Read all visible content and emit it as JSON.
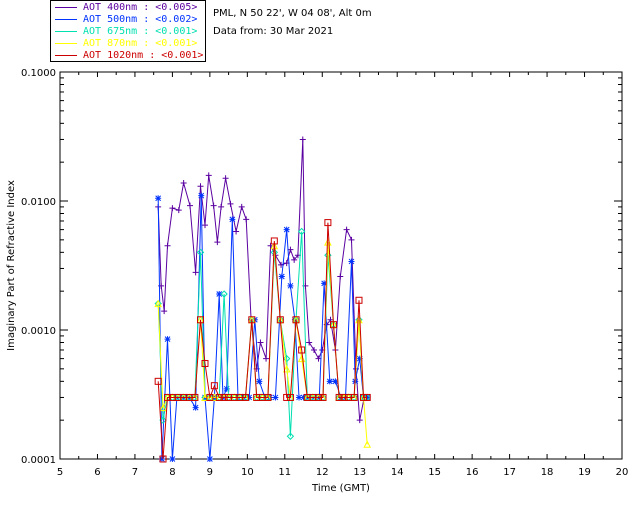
{
  "header": {
    "location": "PML, N 50 22', W 04 08', Alt 0m",
    "date_line": "Data from: 30 Mar 2021"
  },
  "legend": [
    {
      "label": "AOT  400nm : <0.005>",
      "color": "#5a00a0"
    },
    {
      "label": "AOT  500nm : <0.002>",
      "color": "#0033ff"
    },
    {
      "label": "AOT  675nm : <0.001>",
      "color": "#00e0b0"
    },
    {
      "label": "AOT  870nm : <0.001>",
      "color": "#ffff00"
    },
    {
      "label": "AOT 1020nm : <0.001>",
      "color": "#cc0000"
    }
  ],
  "chart_data": {
    "type": "line",
    "title": "",
    "xlabel": "Time (GMT)",
    "ylabel": "Imaginary Part of Refractive Index",
    "xlim": [
      5,
      20
    ],
    "ylim": [
      0.0001,
      0.1
    ],
    "yscale": "log",
    "x_ticks": [
      "5",
      "6",
      "7",
      "8",
      "9",
      "10",
      "11",
      "12",
      "13",
      "14",
      "15",
      "16",
      "17",
      "18",
      "19",
      "20"
    ],
    "y_ticks": [
      "0.0001",
      "0.0010",
      "0.0100",
      "0.1000"
    ],
    "series": [
      {
        "name": "AOT  400nm : <0.005>",
        "marker": "plus",
        "color": "#5a00a0",
        "x": [
          7.62,
          7.7,
          7.78,
          7.87,
          8.0,
          8.17,
          8.3,
          8.47,
          8.62,
          8.75,
          8.87,
          8.97,
          9.1,
          9.2,
          9.3,
          9.42,
          9.55,
          9.7,
          9.85,
          9.97,
          10.1,
          10.25,
          10.35,
          10.5,
          10.62,
          10.75,
          10.9,
          11.05,
          11.15,
          11.25,
          11.35,
          11.48,
          11.55,
          11.65,
          11.78,
          11.9,
          12.0,
          12.12,
          12.22,
          12.35,
          12.48,
          12.65,
          12.78,
          12.9,
          13.0,
          13.12
        ],
        "y": [
          0.009,
          0.0022,
          0.0014,
          0.0045,
          0.0088,
          0.0085,
          0.0138,
          0.0092,
          0.0028,
          0.013,
          0.0065,
          0.0158,
          0.0092,
          0.0048,
          0.009,
          0.015,
          0.0095,
          0.0058,
          0.009,
          0.0072,
          0.0012,
          0.0005,
          0.0008,
          0.0006,
          0.0045,
          0.0038,
          0.0032,
          0.0033,
          0.0042,
          0.0035,
          0.0038,
          0.03,
          0.0022,
          0.0008,
          0.0007,
          0.0006,
          0.0007,
          0.0011,
          0.0012,
          0.0007,
          0.0026,
          0.006,
          0.005,
          0.0005,
          0.0002,
          0.0003
        ]
      },
      {
        "name": "AOT  500nm : <0.002>",
        "marker": "asterisk",
        "color": "#0033ff",
        "x": [
          7.62,
          7.72,
          7.87,
          8.0,
          8.12,
          8.3,
          8.45,
          8.62,
          8.77,
          8.87,
          9.0,
          9.12,
          9.25,
          9.35,
          9.45,
          9.6,
          9.75,
          9.9,
          10.05,
          10.2,
          10.32,
          10.47,
          10.6,
          10.75,
          10.92,
          11.05,
          11.15,
          11.27,
          11.38,
          11.5,
          11.62,
          11.78,
          11.92,
          12.05,
          12.2,
          12.35,
          12.5,
          12.62,
          12.78,
          12.88,
          13.0,
          13.1,
          13.2
        ],
        "y": [
          0.0105,
          8e-05,
          0.00085,
          0.0001,
          0.0003,
          0.0003,
          0.0003,
          0.00025,
          0.011,
          0.0003,
          5e-05,
          0.0003,
          0.0019,
          0.0003,
          0.00035,
          0.0072,
          0.0003,
          0.0003,
          0.0003,
          0.0012,
          0.0004,
          0.0003,
          0.0003,
          0.0003,
          0.0026,
          0.006,
          0.0022,
          0.0012,
          0.0003,
          0.0003,
          0.0003,
          0.0003,
          0.0003,
          0.0023,
          0.0004,
          0.0004,
          0.0003,
          0.0003,
          0.0034,
          0.0004,
          0.0006,
          0.0003,
          0.0003
        ]
      },
      {
        "name": "AOT  675nm : <0.001>",
        "marker": "diamond",
        "color": "#00e0b0",
        "x": [
          7.62,
          7.75,
          7.87,
          8.0,
          8.15,
          8.3,
          8.45,
          8.6,
          8.75,
          8.87,
          9.0,
          9.12,
          9.25,
          9.38,
          9.5,
          9.65,
          9.8,
          9.95,
          10.12,
          10.25,
          10.4,
          10.55,
          10.72,
          10.88,
          11.05,
          11.15,
          11.3,
          11.45,
          11.6,
          11.75,
          11.9,
          12.02,
          12.15,
          12.3,
          12.45,
          12.58,
          12.7,
          12.85,
          12.98,
          13.1,
          13.2
        ],
        "y": [
          0.0016,
          0.0002,
          0.0003,
          0.0003,
          0.0003,
          0.0003,
          0.0003,
          0.0003,
          0.004,
          0.0003,
          0.0003,
          0.0003,
          0.0003,
          0.0019,
          0.0003,
          0.0003,
          0.0003,
          0.0003,
          0.0012,
          0.0003,
          0.0003,
          0.0003,
          0.004,
          0.0012,
          0.0006,
          0.00015,
          0.0012,
          0.0058,
          0.0003,
          0.0003,
          0.0003,
          0.0003,
          0.0038,
          0.0011,
          0.0003,
          0.0003,
          0.0003,
          0.0003,
          0.0012,
          0.0003,
          0.0003
        ]
      },
      {
        "name": "AOT  870nm : <0.001>",
        "marker": "triangle",
        "color": "#ffff00",
        "x": [
          7.62,
          7.75,
          7.87,
          8.0,
          8.15,
          8.3,
          8.45,
          8.6,
          8.75,
          8.87,
          9.0,
          9.12,
          9.25,
          9.38,
          9.5,
          9.65,
          9.8,
          9.95,
          10.12,
          10.25,
          10.4,
          10.55,
          10.72,
          10.88,
          11.05,
          11.15,
          11.3,
          11.45,
          11.6,
          11.75,
          11.9,
          12.02,
          12.15,
          12.3,
          12.45,
          12.58,
          12.7,
          12.85,
          12.98,
          13.1,
          13.2
        ],
        "y": [
          0.0016,
          0.00025,
          0.0003,
          0.0003,
          0.0003,
          0.0003,
          0.0003,
          0.0003,
          0.0012,
          0.0003,
          0.0003,
          0.0003,
          0.0003,
          0.0003,
          0.0003,
          0.0003,
          0.0003,
          0.0003,
          0.0012,
          0.0003,
          0.0003,
          0.0003,
          0.0045,
          0.0012,
          0.0005,
          0.0003,
          0.0012,
          0.0006,
          0.0003,
          0.0003,
          0.0003,
          0.0003,
          0.0048,
          0.0011,
          0.0003,
          0.0003,
          0.0003,
          0.0003,
          0.0012,
          0.0003,
          0.00013
        ]
      },
      {
        "name": "AOT 1020nm : <0.001>",
        "marker": "square",
        "color": "#cc0000",
        "x": [
          7.62,
          7.75,
          7.87,
          8.0,
          8.15,
          8.3,
          8.45,
          8.6,
          8.75,
          8.87,
          9.0,
          9.12,
          9.25,
          9.38,
          9.5,
          9.65,
          9.8,
          9.95,
          10.12,
          10.25,
          10.4,
          10.55,
          10.72,
          10.88,
          11.05,
          11.15,
          11.3,
          11.45,
          11.6,
          11.75,
          11.9,
          12.02,
          12.15,
          12.3,
          12.45,
          12.58,
          12.7,
          12.85,
          12.98,
          13.1,
          13.2
        ],
        "y": [
          0.0004,
          0.0001,
          0.0003,
          0.0003,
          0.0003,
          0.0003,
          0.0003,
          0.0003,
          0.0012,
          0.00055,
          0.0003,
          0.00037,
          0.0003,
          0.0003,
          0.0003,
          0.0003,
          0.0003,
          0.0003,
          0.0012,
          0.0003,
          0.0003,
          0.0003,
          0.0049,
          0.0012,
          0.0003,
          0.0003,
          0.0012,
          0.0007,
          0.0003,
          0.0003,
          0.0003,
          0.0003,
          0.0068,
          0.0011,
          0.0003,
          0.0003,
          0.0003,
          0.0003,
          0.0017,
          0.0003,
          0.0003
        ]
      }
    ]
  }
}
